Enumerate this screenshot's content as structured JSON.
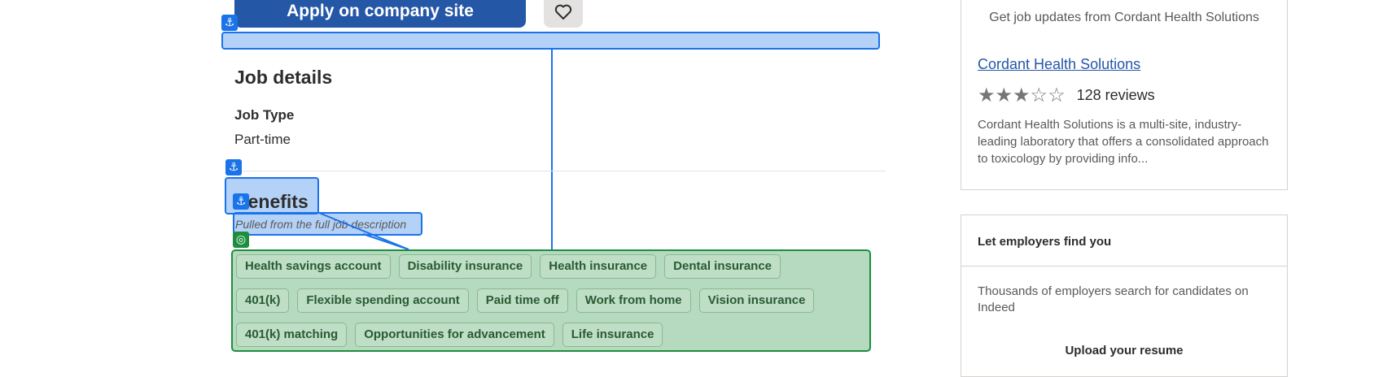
{
  "apply": {
    "label": "Apply on company site"
  },
  "save": {
    "icon": "heart-icon"
  },
  "job_details": {
    "title": "Job details",
    "job_type_label": "Job Type",
    "job_type_value": "Part-time"
  },
  "benefits": {
    "title": "Benefits",
    "note": "Pulled from the full job description",
    "rows": [
      [
        "Health savings account",
        "Disability insurance",
        "Health insurance",
        "Dental insurance"
      ],
      [
        "401(k)",
        "Flexible spending account",
        "Paid time off",
        "Work from home",
        "Vision insurance"
      ],
      [
        "401(k) matching",
        "Opportunities for advancement",
        "Life insurance"
      ]
    ]
  },
  "company_card": {
    "updates_text": "Get job updates from Cordant Health Solutions",
    "company_name": "Cordant Health Solutions",
    "rating": 3,
    "rating_max": 5,
    "reviews": "128 reviews",
    "description": "Cordant Health Solutions is a multi-site, industry-leading laboratory that offers a consolidated approach to toxicology by providing info..."
  },
  "employers_card": {
    "title": "Let employers find you",
    "text": "Thousands of employers search for candidates on Indeed",
    "upload_label": "Upload your resume"
  },
  "colors": {
    "primary": "#2557a7",
    "annotation_blue": "#1a73e8",
    "annotation_green": "#1e8e3e"
  }
}
